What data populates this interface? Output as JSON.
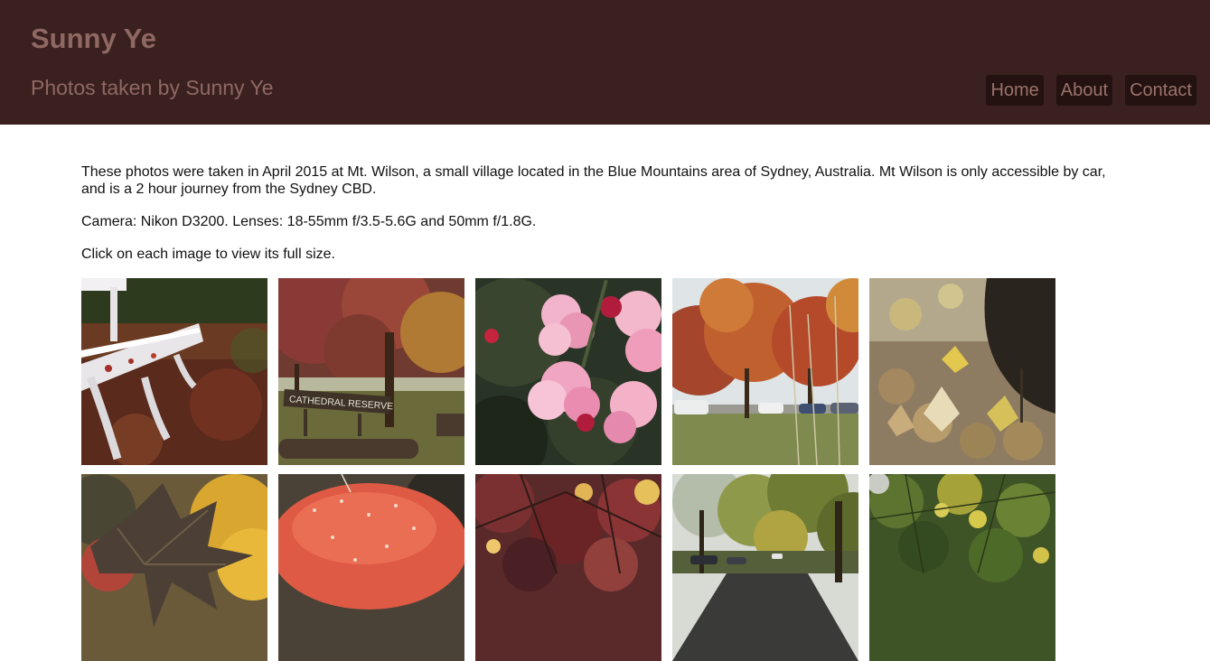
{
  "header": {
    "title": "Sunny Ye",
    "subtitle": "Photos taken by Sunny Ye",
    "nav": [
      {
        "label": "Home"
      },
      {
        "label": "About"
      },
      {
        "label": "Contact"
      }
    ]
  },
  "content": {
    "intro": "These photos were taken in April 2015 at Mt. Wilson, a small village located in the Blue Mountains area of Sydney, Australia. Mt Wilson is only accessible by car, and is a 2 hour journey from the Sydney CBD.",
    "camera": "Camera: Nikon D3200. Lenses: 18-55mm f/3.5-5.6G and 50mm f/1.8G.",
    "instructions": "Click on each image to view its full size."
  },
  "gallery": {
    "sign_text": "CATHEDRAL RESERVE"
  },
  "colors": {
    "header_bg": "#3a201f",
    "header_text": "#8f6863",
    "nav_bg": "#241210"
  }
}
